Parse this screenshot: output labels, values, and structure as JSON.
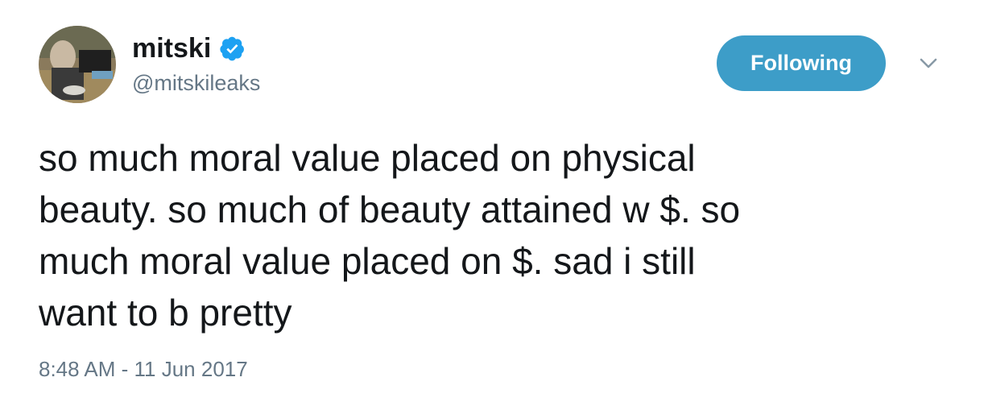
{
  "user": {
    "display_name": "mitski",
    "handle": "@mitskileaks",
    "verified": true,
    "avatar_icon": "profile-photo"
  },
  "follow_button": {
    "label": "Following"
  },
  "menu": {
    "icon": "chevron-down-icon"
  },
  "tweet": {
    "lines": [
      "so much moral value placed on physical",
      "beauty. so much of beauty attained w $. so",
      "much moral value placed on $. sad i still",
      "want to b pretty"
    ],
    "timestamp": "8:48 AM - 11 Jun 2017"
  },
  "colors": {
    "button_bg": "#3d9dc8",
    "verified_blue": "#1da1f2",
    "secondary_text": "#657786",
    "primary_text": "#14171a"
  }
}
